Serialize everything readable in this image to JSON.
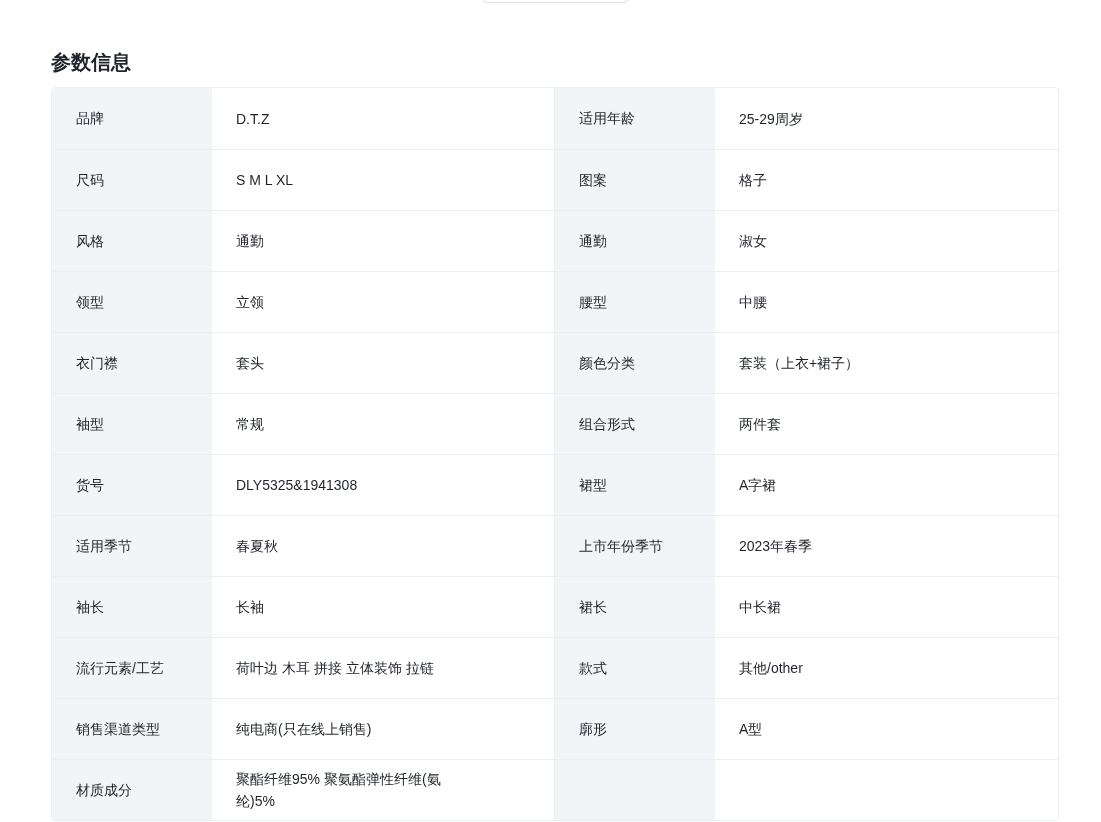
{
  "title": "参数信息",
  "rows": [
    {
      "cells": [
        {
          "label": "品牌",
          "value": "D.T.Z"
        },
        {
          "label": "适用年龄",
          "value": "25-29周岁"
        }
      ]
    },
    {
      "cells": [
        {
          "label": "尺码",
          "value": "S M L XL"
        },
        {
          "label": "图案",
          "value": "格子"
        }
      ]
    },
    {
      "cells": [
        {
          "label": "风格",
          "value": "通勤"
        },
        {
          "label": "通勤",
          "value": "淑女"
        }
      ]
    },
    {
      "cells": [
        {
          "label": "领型",
          "value": "立领"
        },
        {
          "label": "腰型",
          "value": "中腰"
        }
      ]
    },
    {
      "cells": [
        {
          "label": "衣门襟",
          "value": "套头"
        },
        {
          "label": "颜色分类",
          "value": "套装（上衣+裙子）"
        }
      ]
    },
    {
      "cells": [
        {
          "label": "袖型",
          "value": "常规"
        },
        {
          "label": "组合形式",
          "value": "两件套"
        }
      ]
    },
    {
      "cells": [
        {
          "label": "货号",
          "value": "DLY5325&1941308"
        },
        {
          "label": "裙型",
          "value": "A字裙"
        }
      ]
    },
    {
      "cells": [
        {
          "label": "适用季节",
          "value": "春夏秋"
        },
        {
          "label": "上市年份季节",
          "value": "2023年春季"
        }
      ]
    },
    {
      "cells": [
        {
          "label": "袖长",
          "value": "长袖"
        },
        {
          "label": "裙长",
          "value": "中长裙"
        }
      ]
    },
    {
      "cells": [
        {
          "label": "流行元素/工艺",
          "value": "荷叶边 木耳 拼接 立体装饰 拉链"
        },
        {
          "label": "款式",
          "value": "其他/other"
        }
      ]
    },
    {
      "cells": [
        {
          "label": "销售渠道类型",
          "value": "纯电商(只在线上销售)"
        },
        {
          "label": "廓形",
          "value": "A型"
        }
      ]
    },
    {
      "cells": [
        {
          "label": "材质成分",
          "value": "聚酯纤维95% 聚氨酯弹性纤维(氨纶)5%"
        },
        {}
      ]
    }
  ]
}
